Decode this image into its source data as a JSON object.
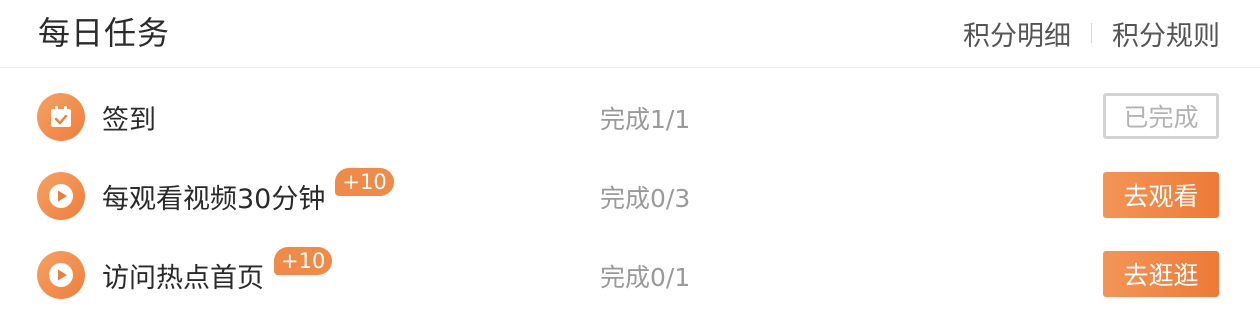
{
  "header": {
    "title": "每日任务",
    "links": [
      "积分明细",
      "积分规则"
    ]
  },
  "colors": {
    "accent": "#ef8a48",
    "muted_text": "#9a9a9a",
    "done_border": "#d3d3d3"
  },
  "tasks": [
    {
      "name": "签到",
      "icon": "calendar-check-icon",
      "bonus": "",
      "progress": "完成1/1",
      "button": "已完成",
      "status": "done"
    },
    {
      "name": "每观看视频30分钟",
      "icon": "play-icon",
      "bonus": "+10",
      "progress": "完成0/3",
      "button": "去观看",
      "status": "todo"
    },
    {
      "name": "访问热点首页",
      "icon": "play-icon",
      "bonus": "+10",
      "progress": "完成0/1",
      "button": "去逛逛",
      "status": "todo"
    }
  ]
}
